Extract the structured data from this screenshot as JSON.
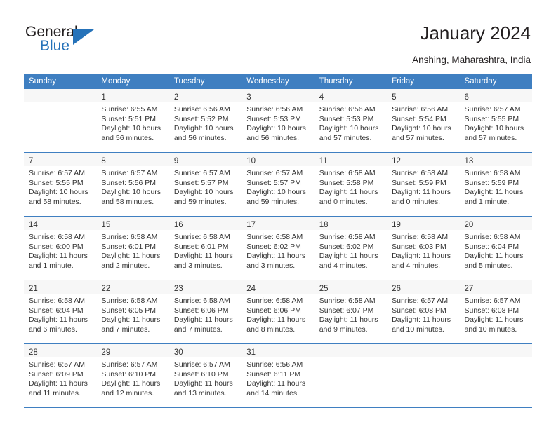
{
  "brand": {
    "name_top": "General",
    "name_bottom": "Blue",
    "triangle_color": "#2572b9"
  },
  "header": {
    "title": "January 2024",
    "subtitle": "Anshing, Maharashtra, India"
  },
  "theme": {
    "header_blue": "#3f7fc1",
    "row_shade": "#ececec",
    "row_light": "#f7f7f7",
    "text": "#333333"
  },
  "calendar": {
    "weekday_headers": [
      "Sunday",
      "Monday",
      "Tuesday",
      "Wednesday",
      "Thursday",
      "Friday",
      "Saturday"
    ],
    "weeks": [
      {
        "shaded": false,
        "days": [
          {
            "num": "",
            "lines": []
          },
          {
            "num": "1",
            "lines": [
              "Sunrise: 6:55 AM",
              "Sunset: 5:51 PM",
              "Daylight: 10 hours",
              "and 56 minutes."
            ]
          },
          {
            "num": "2",
            "lines": [
              "Sunrise: 6:56 AM",
              "Sunset: 5:52 PM",
              "Daylight: 10 hours",
              "and 56 minutes."
            ]
          },
          {
            "num": "3",
            "lines": [
              "Sunrise: 6:56 AM",
              "Sunset: 5:53 PM",
              "Daylight: 10 hours",
              "and 56 minutes."
            ]
          },
          {
            "num": "4",
            "lines": [
              "Sunrise: 6:56 AM",
              "Sunset: 5:53 PM",
              "Daylight: 10 hours",
              "and 57 minutes."
            ]
          },
          {
            "num": "5",
            "lines": [
              "Sunrise: 6:56 AM",
              "Sunset: 5:54 PM",
              "Daylight: 10 hours",
              "and 57 minutes."
            ]
          },
          {
            "num": "6",
            "lines": [
              "Sunrise: 6:57 AM",
              "Sunset: 5:55 PM",
              "Daylight: 10 hours",
              "and 57 minutes."
            ]
          }
        ]
      },
      {
        "shaded": true,
        "days": [
          {
            "num": "7",
            "lines": [
              "Sunrise: 6:57 AM",
              "Sunset: 5:55 PM",
              "Daylight: 10 hours",
              "and 58 minutes."
            ]
          },
          {
            "num": "8",
            "lines": [
              "Sunrise: 6:57 AM",
              "Sunset: 5:56 PM",
              "Daylight: 10 hours",
              "and 58 minutes."
            ]
          },
          {
            "num": "9",
            "lines": [
              "Sunrise: 6:57 AM",
              "Sunset: 5:57 PM",
              "Daylight: 10 hours",
              "and 59 minutes."
            ]
          },
          {
            "num": "10",
            "lines": [
              "Sunrise: 6:57 AM",
              "Sunset: 5:57 PM",
              "Daylight: 10 hours",
              "and 59 minutes."
            ]
          },
          {
            "num": "11",
            "lines": [
              "Sunrise: 6:58 AM",
              "Sunset: 5:58 PM",
              "Daylight: 11 hours",
              "and 0 minutes."
            ]
          },
          {
            "num": "12",
            "lines": [
              "Sunrise: 6:58 AM",
              "Sunset: 5:59 PM",
              "Daylight: 11 hours",
              "and 0 minutes."
            ]
          },
          {
            "num": "13",
            "lines": [
              "Sunrise: 6:58 AM",
              "Sunset: 5:59 PM",
              "Daylight: 11 hours",
              "and 1 minute."
            ]
          }
        ]
      },
      {
        "shaded": true,
        "days": [
          {
            "num": "14",
            "lines": [
              "Sunrise: 6:58 AM",
              "Sunset: 6:00 PM",
              "Daylight: 11 hours",
              "and 1 minute."
            ]
          },
          {
            "num": "15",
            "lines": [
              "Sunrise: 6:58 AM",
              "Sunset: 6:01 PM",
              "Daylight: 11 hours",
              "and 2 minutes."
            ]
          },
          {
            "num": "16",
            "lines": [
              "Sunrise: 6:58 AM",
              "Sunset: 6:01 PM",
              "Daylight: 11 hours",
              "and 3 minutes."
            ]
          },
          {
            "num": "17",
            "lines": [
              "Sunrise: 6:58 AM",
              "Sunset: 6:02 PM",
              "Daylight: 11 hours",
              "and 3 minutes."
            ]
          },
          {
            "num": "18",
            "lines": [
              "Sunrise: 6:58 AM",
              "Sunset: 6:02 PM",
              "Daylight: 11 hours",
              "and 4 minutes."
            ]
          },
          {
            "num": "19",
            "lines": [
              "Sunrise: 6:58 AM",
              "Sunset: 6:03 PM",
              "Daylight: 11 hours",
              "and 4 minutes."
            ]
          },
          {
            "num": "20",
            "lines": [
              "Sunrise: 6:58 AM",
              "Sunset: 6:04 PM",
              "Daylight: 11 hours",
              "and 5 minutes."
            ]
          }
        ]
      },
      {
        "shaded": true,
        "days": [
          {
            "num": "21",
            "lines": [
              "Sunrise: 6:58 AM",
              "Sunset: 6:04 PM",
              "Daylight: 11 hours",
              "and 6 minutes."
            ]
          },
          {
            "num": "22",
            "lines": [
              "Sunrise: 6:58 AM",
              "Sunset: 6:05 PM",
              "Daylight: 11 hours",
              "and 7 minutes."
            ]
          },
          {
            "num": "23",
            "lines": [
              "Sunrise: 6:58 AM",
              "Sunset: 6:06 PM",
              "Daylight: 11 hours",
              "and 7 minutes."
            ]
          },
          {
            "num": "24",
            "lines": [
              "Sunrise: 6:58 AM",
              "Sunset: 6:06 PM",
              "Daylight: 11 hours",
              "and 8 minutes."
            ]
          },
          {
            "num": "25",
            "lines": [
              "Sunrise: 6:58 AM",
              "Sunset: 6:07 PM",
              "Daylight: 11 hours",
              "and 9 minutes."
            ]
          },
          {
            "num": "26",
            "lines": [
              "Sunrise: 6:57 AM",
              "Sunset: 6:08 PM",
              "Daylight: 11 hours",
              "and 10 minutes."
            ]
          },
          {
            "num": "27",
            "lines": [
              "Sunrise: 6:57 AM",
              "Sunset: 6:08 PM",
              "Daylight: 11 hours",
              "and 10 minutes."
            ]
          }
        ]
      },
      {
        "shaded": true,
        "days": [
          {
            "num": "28",
            "lines": [
              "Sunrise: 6:57 AM",
              "Sunset: 6:09 PM",
              "Daylight: 11 hours",
              "and 11 minutes."
            ]
          },
          {
            "num": "29",
            "lines": [
              "Sunrise: 6:57 AM",
              "Sunset: 6:10 PM",
              "Daylight: 11 hours",
              "and 12 minutes."
            ]
          },
          {
            "num": "30",
            "lines": [
              "Sunrise: 6:57 AM",
              "Sunset: 6:10 PM",
              "Daylight: 11 hours",
              "and 13 minutes."
            ]
          },
          {
            "num": "31",
            "lines": [
              "Sunrise: 6:56 AM",
              "Sunset: 6:11 PM",
              "Daylight: 11 hours",
              "and 14 minutes."
            ]
          },
          {
            "num": "",
            "lines": []
          },
          {
            "num": "",
            "lines": []
          },
          {
            "num": "",
            "lines": []
          }
        ]
      }
    ]
  }
}
